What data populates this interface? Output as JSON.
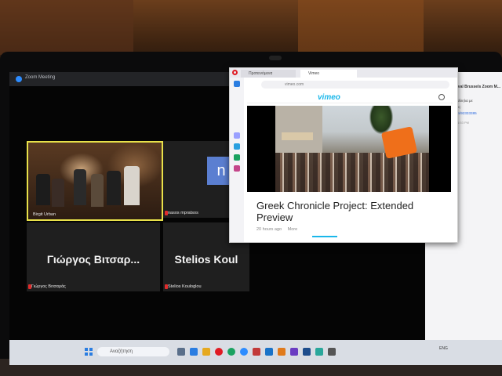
{
  "zoom": {
    "window_title": "Zoom Meeting"
  },
  "participants": [
    {
      "name": "Birgit Urban"
    },
    {
      "name": "nasos mpratsos",
      "initial": "n"
    },
    {
      "name": "Γιώργος Βιτσαράς",
      "display": "Γιώργος Βιτσαρ..."
    },
    {
      "name": "Stelios Kouloglou",
      "display": "Stelios Koul"
    }
  ],
  "chat": {
    "title": "Ikaria Film Festival Brussels Zoom M...",
    "lines": [
      "για το δείτε παράλληλα με",
      "την προβολή τους:",
      "https://vimeo.com/92333385"
    ],
    "meta": "Γιώργος Βιτσαράς 1:53 PM",
    "link": "https://vimeo.com/92333385"
  },
  "browser": {
    "tab1": "Προτεινόμενα",
    "tab2": "Vimeo",
    "url": "vimeo.com",
    "logo": "vimeo",
    "video_title": "Greek Chronicle Project: Extended Preview",
    "video_age": "20 hours ago",
    "more": "More"
  },
  "taskbar": {
    "search_placeholder": "Αναζήτηση",
    "tray_lang": "ENG"
  },
  "colors": {
    "active_speaker_border": "#e8e14a",
    "avatar_bg": "#5b7fd1",
    "vimeo_blue": "#1ab7ea",
    "mic_muted": "#e02c2c"
  }
}
